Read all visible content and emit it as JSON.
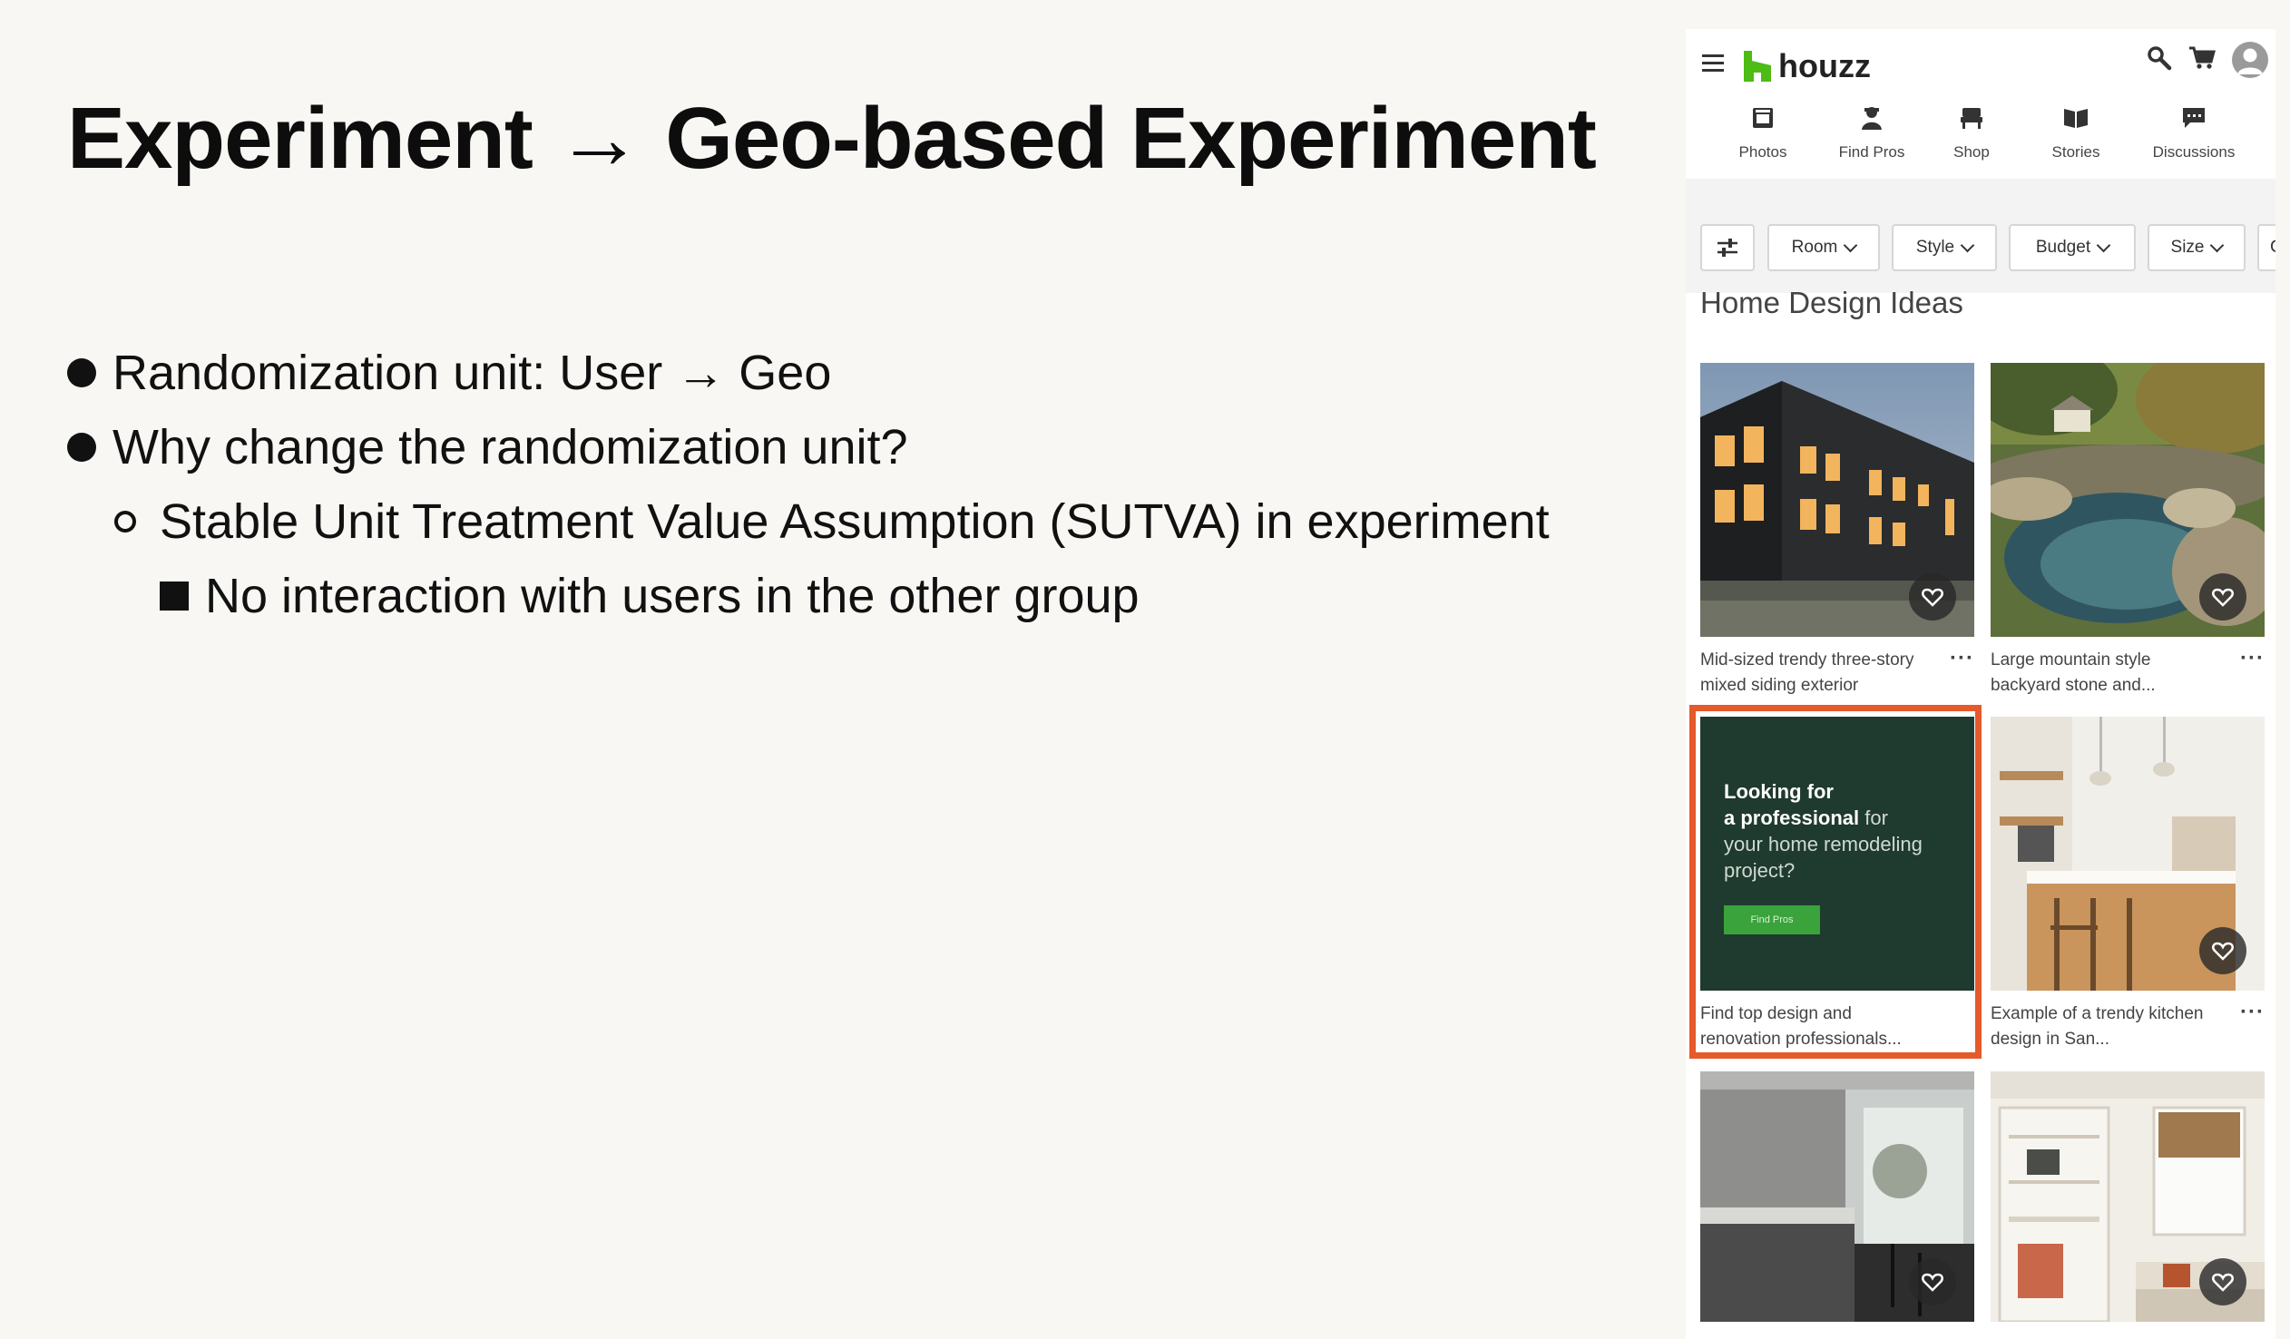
{
  "slide": {
    "title": "Experiment → Geo-based Experiment",
    "bullets": [
      "Randomization unit: User → Geo",
      "Why change the randomization unit?",
      "Stable Unit Treatment Value Assumption (SUTVA) in experiment",
      "No interaction with users in the other group"
    ]
  },
  "app": {
    "logo_text": "houzz",
    "brand_color": "#4dbc15",
    "nav": [
      {
        "label": "Photos",
        "icon": "photos-icon"
      },
      {
        "label": "Find Pros",
        "icon": "find-pros-icon"
      },
      {
        "label": "Shop",
        "icon": "shop-icon"
      },
      {
        "label": "Stories",
        "icon": "stories-icon"
      },
      {
        "label": "Discussions",
        "icon": "discussions-icon"
      }
    ],
    "filters": [
      "Room",
      "Style",
      "Budget",
      "Size",
      "C"
    ],
    "section_title": "Home Design Ideas",
    "cards": [
      {
        "caption": "Mid-sized trendy three-story mixed siding exterior"
      },
      {
        "caption": "Large mountain style backyard stone and..."
      },
      {
        "caption": "Find top design and renovation professionals..."
      },
      {
        "caption": "Example of a trendy kitchen design in San..."
      },
      {
        "caption": ""
      },
      {
        "caption": ""
      }
    ],
    "promo": {
      "line1": "Looking for",
      "line2_bold": "a professional",
      "line2_rest": " for",
      "line3": "your home remodeling project?",
      "button": "Find Pros",
      "bg_color": "#1f3a2e",
      "highlight_color": "#e5592a"
    }
  }
}
